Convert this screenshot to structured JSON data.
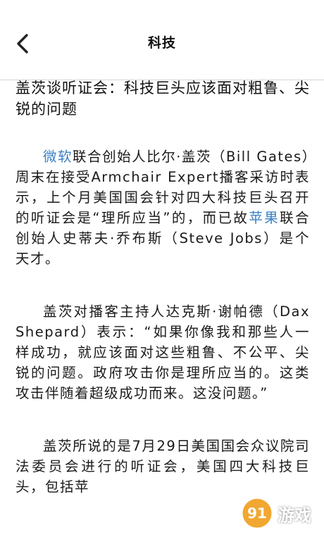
{
  "header": {
    "title": "科技"
  },
  "article": {
    "title": "盖茨谈听证会：科技巨头应该面对粗鲁、尖锐的问题",
    "p1": {
      "link1": "微软",
      "t1": "联合创始人比尔·盖茨（Bill Gates）周末在接受Armchair Expert播客采访时表示，上个月美国国会针对四大科技巨头召开的听证会是“理所应当”的，而已故",
      "link2": "苹果",
      "t2": "联合创始人史蒂夫·乔布斯（Steve Jobs）是个天才。"
    },
    "p2": "盖茨对播客主持人达克斯·谢帕德（Dax Shepard）表示：“如果你像我和那些人一样成功，就应该面对这些粗鲁、不公平、尖锐的问题。政府攻击你是理所应当的。这类攻击伴随着超级成功而来。这没问题。”",
    "p3": "盖茨所说的是7月29日美国国会众议院司法委员会进行的听证会，美国四大科技巨头，包括苹"
  },
  "watermark": {
    "text": "游戏",
    "brand_color": "#f0a020"
  }
}
